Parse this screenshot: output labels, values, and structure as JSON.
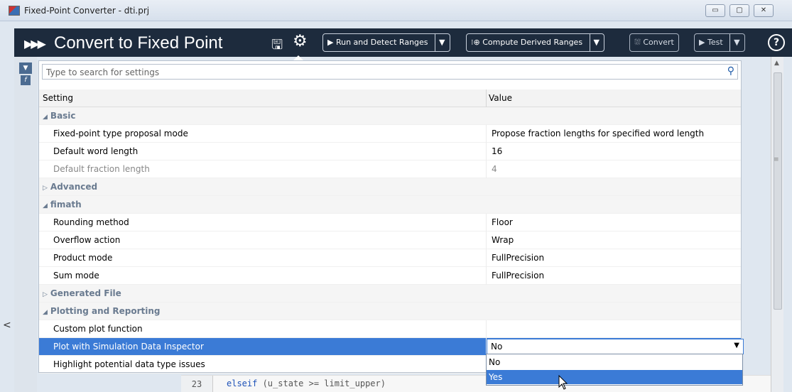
{
  "window": {
    "title": "Fixed-Point Converter - dti.prj"
  },
  "toolbar": {
    "title": "Convert to Fixed Point",
    "run_label": "Run and Detect Ranges",
    "derived_label": "Compute Derived Ranges",
    "convert_label": "Convert",
    "test_label": "Test",
    "help": "?"
  },
  "search": {
    "placeholder": "Type to search for settings"
  },
  "grid": {
    "col_setting": "Setting",
    "col_value": "Value",
    "rows": [
      {
        "type": "section",
        "arrow": "◢",
        "label": "Basic"
      },
      {
        "label": "Fixed-point type proposal mode",
        "value": "Propose fraction lengths for specified word length"
      },
      {
        "label": "Default word length",
        "value": "16"
      },
      {
        "label": "Default fraction length",
        "value": "4",
        "dim": true
      },
      {
        "type": "section",
        "arrow": "▷",
        "label": "Advanced"
      },
      {
        "type": "section",
        "arrow": "◢",
        "label": "fimath"
      },
      {
        "label": "Rounding method",
        "value": "Floor"
      },
      {
        "label": "Overflow action",
        "value": "Wrap"
      },
      {
        "label": "Product mode",
        "value": "FullPrecision"
      },
      {
        "label": "Sum mode",
        "value": "FullPrecision"
      },
      {
        "type": "section",
        "arrow": "▷",
        "label": "Generated File"
      },
      {
        "type": "section",
        "arrow": "◢",
        "label": "Plotting and Reporting"
      },
      {
        "label": "Custom plot function",
        "value": ""
      },
      {
        "label": "Plot with Simulation Data Inspector",
        "value": "No",
        "selected": true
      },
      {
        "label": "Highlight potential data type issues",
        "value": ""
      }
    ]
  },
  "dropdown": {
    "options": [
      "No",
      "Yes"
    ],
    "highlighted": "Yes"
  },
  "code": {
    "line_number": "23",
    "keyword": "elseif",
    "text": " (u_state >= limit_upper)"
  },
  "colors": {
    "toolbar_bg": "#1d2b3d",
    "selection": "#3b7bd6",
    "section_text": "#6a7b90"
  }
}
